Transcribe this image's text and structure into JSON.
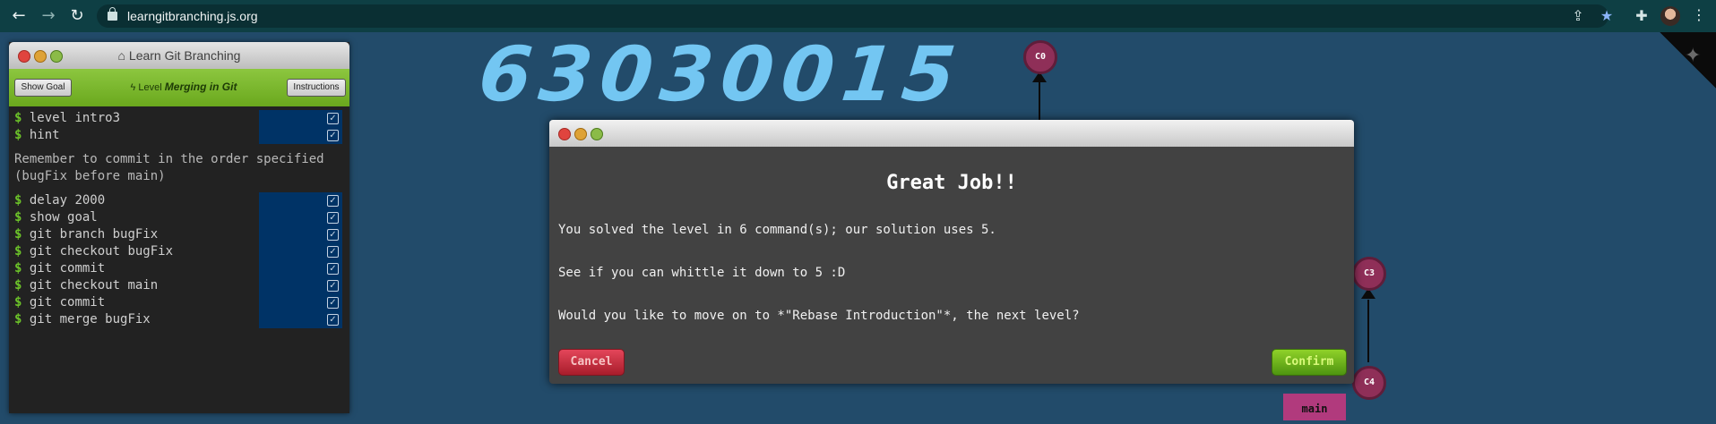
{
  "browser": {
    "url": "learngitbranching.js.org",
    "icons": [
      "back-arrow-icon",
      "forward-arrow-icon",
      "reload-icon",
      "lock-icon",
      "share-icon",
      "star-icon",
      "extensions-icon",
      "profile-avatar",
      "more-icon"
    ]
  },
  "left_panel": {
    "title": "Learn Git Branching",
    "show_goal": "Show Goal",
    "level_prefix": "Level",
    "level_name": "Merging in Git",
    "instructions": "Instructions",
    "commands_top": [
      {
        "prompt": "$",
        "text": "level intro3"
      },
      {
        "prompt": "$",
        "text": "hint"
      }
    ],
    "note_line1": "Remember to commit in the order specified",
    "note_line2": "(bugFix before main)",
    "commands_bottom": [
      {
        "prompt": "$",
        "text": "delay 2000"
      },
      {
        "prompt": "$",
        "text": "show goal"
      },
      {
        "prompt": "$",
        "text": "git branch bugFix"
      },
      {
        "prompt": "$",
        "text": "git checkout bugFix"
      },
      {
        "prompt": "$",
        "text": "git commit"
      },
      {
        "prompt": "$",
        "text": "git checkout main"
      },
      {
        "prompt": "$",
        "text": "git commit"
      },
      {
        "prompt": "$",
        "text": "git merge bugFix"
      }
    ]
  },
  "handwriting": "63030015",
  "graph": {
    "nodes": [
      "C0",
      "C3",
      "C4"
    ],
    "branch_label": "main"
  },
  "modal": {
    "heading": "Great Job!!",
    "line1": "You solved the level in 6 command(s); our solution uses 5.",
    "line2": "See if you can whittle it down to 5 :D",
    "line3": "Would you like to move on to *\"Rebase Introduction\"*, the next level?",
    "cancel": "Cancel",
    "confirm": "Confirm"
  },
  "colors": {
    "background": "#224b6a",
    "chrome": "#0e3f44",
    "handwriting": "#73c6f2",
    "node": "#8f2f58",
    "terminal_prompt": "#6cc229"
  }
}
